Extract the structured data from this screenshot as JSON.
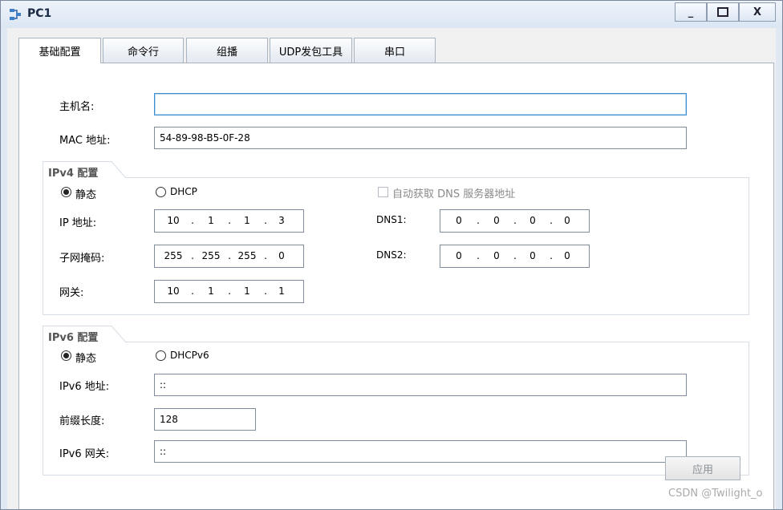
{
  "window": {
    "title": "PC1",
    "min_label": "_",
    "max_label": "□",
    "close_label": "X"
  },
  "tabs": [
    {
      "label": "基础配置",
      "active": true
    },
    {
      "label": "命令行"
    },
    {
      "label": "组播"
    },
    {
      "label": "UDP发包工具"
    },
    {
      "label": "串口"
    }
  ],
  "basic": {
    "hostname_label": "主机名:",
    "hostname_value": "",
    "mac_label": "MAC 地址:",
    "mac_value": "54-89-98-B5-0F-28"
  },
  "ipv4": {
    "title": "IPv4 配置",
    "static_label": "静态",
    "dhcp_label": "DHCP",
    "auto_dns_label": "自动获取 DNS 服务器地址",
    "ip_label": "IP 地址:",
    "ip": [
      "10",
      "1",
      "1",
      "3"
    ],
    "mask_label": "子网掩码:",
    "mask": [
      "255",
      "255",
      "255",
      "0"
    ],
    "gateway_label": "网关:",
    "gateway": [
      "10",
      "1",
      "1",
      "1"
    ],
    "dns1_label": "DNS1:",
    "dns1": [
      "0",
      "0",
      "0",
      "0"
    ],
    "dns2_label": "DNS2:",
    "dns2": [
      "0",
      "0",
      "0",
      "0"
    ]
  },
  "ipv6": {
    "title": "IPv6 配置",
    "static_label": "静态",
    "dhcp_label": "DHCPv6",
    "addr_label": "IPv6 地址:",
    "addr_value": "::",
    "prefix_label": "前缀长度:",
    "prefix_value": "128",
    "gateway_label": "IPv6 网关:",
    "gateway_value": "::"
  },
  "apply_label": "应用",
  "watermark": "CSDN @Twilight_o"
}
